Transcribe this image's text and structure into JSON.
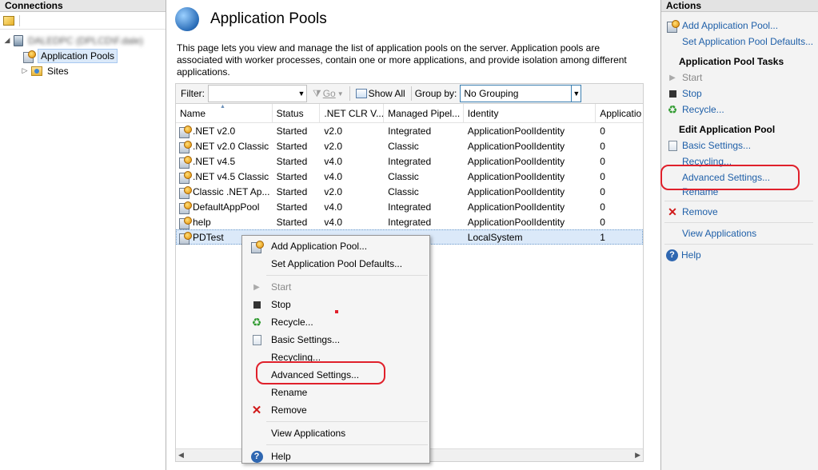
{
  "connections": {
    "header": "Connections",
    "tree": {
      "server_label": "DALEDPC (DPLCD\\F.dale)",
      "items": [
        {
          "label": "Application Pools",
          "selected": true
        },
        {
          "label": "Sites",
          "selected": false
        }
      ]
    }
  },
  "main": {
    "title": "Application Pools",
    "description": "This page lets you view and manage the list of application pools on the server. Application pools are associated with worker processes, contain one or more applications, and provide isolation among different applications.",
    "filter": {
      "filter_label": "Filter:",
      "filter_value": "",
      "go_label": "Go",
      "show_all_label": "Show All",
      "group_by_label": "Group by:",
      "group_by_value": "No Grouping"
    },
    "grid": {
      "columns": [
        "Name",
        "Status",
        ".NET CLR V...",
        "Managed Pipel...",
        "Identity",
        "Applicatio"
      ],
      "rows": [
        {
          "name": ".NET v2.0",
          "status": "Started",
          "clr": "v2.0",
          "pipeline": "Integrated",
          "identity": "ApplicationPoolIdentity",
          "apps": "0"
        },
        {
          "name": ".NET v2.0 Classic",
          "status": "Started",
          "clr": "v2.0",
          "pipeline": "Classic",
          "identity": "ApplicationPoolIdentity",
          "apps": "0"
        },
        {
          "name": ".NET v4.5",
          "status": "Started",
          "clr": "v4.0",
          "pipeline": "Integrated",
          "identity": "ApplicationPoolIdentity",
          "apps": "0"
        },
        {
          "name": ".NET v4.5 Classic",
          "status": "Started",
          "clr": "v4.0",
          "pipeline": "Classic",
          "identity": "ApplicationPoolIdentity",
          "apps": "0"
        },
        {
          "name": "Classic .NET Ap...",
          "status": "Started",
          "clr": "v2.0",
          "pipeline": "Classic",
          "identity": "ApplicationPoolIdentity",
          "apps": "0"
        },
        {
          "name": "DefaultAppPool",
          "status": "Started",
          "clr": "v4.0",
          "pipeline": "Integrated",
          "identity": "ApplicationPoolIdentity",
          "apps": "0"
        },
        {
          "name": "help",
          "status": "Started",
          "clr": "v4.0",
          "pipeline": "Integrated",
          "identity": "ApplicationPoolIdentity",
          "apps": "0"
        },
        {
          "name": "PDTest",
          "status": "",
          "clr": "",
          "pipeline": "",
          "identity": "LocalSystem",
          "apps": "1",
          "selected": true
        }
      ]
    }
  },
  "context_menu": {
    "items": [
      {
        "label": "Add Application Pool...",
        "icon": "add-pool-icon",
        "enabled": true
      },
      {
        "label": "Set Application Pool Defaults...",
        "icon": "",
        "enabled": true
      },
      {
        "separator": true
      },
      {
        "label": "Start",
        "icon": "play-icon",
        "enabled": false
      },
      {
        "label": "Stop",
        "icon": "stop-icon",
        "enabled": true
      },
      {
        "label": "Recycle...",
        "icon": "recycle-icon",
        "enabled": true
      },
      {
        "label": "Basic Settings...",
        "icon": "settings-page-icon",
        "enabled": true
      },
      {
        "label": "Recycling...",
        "icon": "",
        "enabled": true
      },
      {
        "label": "Advanced Settings...",
        "icon": "",
        "enabled": true,
        "highlighted": true
      },
      {
        "label": "Rename",
        "icon": "",
        "enabled": true
      },
      {
        "label": "Remove",
        "icon": "remove-x-icon",
        "enabled": true
      },
      {
        "separator": true
      },
      {
        "label": "View Applications",
        "icon": "",
        "enabled": true
      },
      {
        "separator": true
      },
      {
        "label": "Help",
        "icon": "help-icon",
        "enabled": true
      }
    ]
  },
  "actions": {
    "header": "Actions",
    "top_links": [
      "Add Application Pool...",
      "Set Application Pool Defaults..."
    ],
    "tasks_heading": "Application Pool Tasks",
    "tasks": [
      {
        "label": "Start",
        "icon": "play-icon",
        "enabled": false
      },
      {
        "label": "Stop",
        "icon": "stop-icon",
        "enabled": true
      },
      {
        "label": "Recycle...",
        "icon": "recycle-icon",
        "enabled": true
      }
    ],
    "edit_heading": "Edit Application Pool",
    "edit_items": [
      {
        "label": "Basic Settings...",
        "icon": "settings-page-icon"
      },
      {
        "label": "Recycling...",
        "icon": ""
      },
      {
        "label": "Advanced Settings...",
        "icon": "",
        "highlighted": true
      },
      {
        "label": "Rename",
        "icon": ""
      }
    ],
    "remove_label": "Remove",
    "view_apps_label": "View Applications",
    "help_label": "Help"
  },
  "colors": {
    "link": "#1e5fa8",
    "annotation": "#e0202b",
    "selection": "#dbe9f9"
  }
}
